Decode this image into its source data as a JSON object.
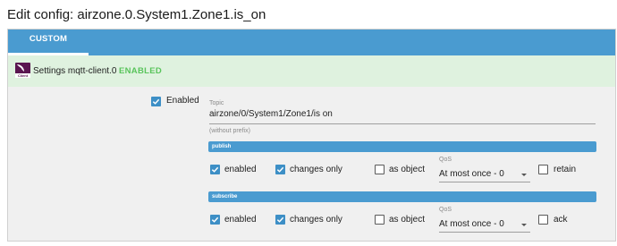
{
  "page": {
    "title": "Edit config: airzone.0.System1.Zone1.is_on"
  },
  "tabs": [
    {
      "label": "CUSTOM SETTINGS",
      "active": true
    }
  ],
  "adapter": {
    "logo_text": "Client",
    "name": "Settings mqtt-client.0",
    "status": "ENABLED"
  },
  "form": {
    "enabled": {
      "label": "Enabled",
      "checked": true
    },
    "topic": {
      "label": "Topic",
      "value": "airzone/0/System1/Zone1/is on",
      "hint": "(without prefix)"
    },
    "publish": {
      "header": "publish",
      "enabled": {
        "label": "enabled",
        "checked": true
      },
      "changes_only": {
        "label": "changes only",
        "checked": true
      },
      "as_object": {
        "label": "as object",
        "checked": false
      },
      "qos": {
        "label": "QoS",
        "value": "At most once - 0"
      },
      "extra": {
        "label": "retain",
        "checked": false
      }
    },
    "subscribe": {
      "header": "subscribe",
      "enabled": {
        "label": "enabled",
        "checked": true
      },
      "changes_only": {
        "label": "changes only",
        "checked": true
      },
      "as_object": {
        "label": "as object",
        "checked": false
      },
      "qos": {
        "label": "QoS",
        "value": "At most once - 0"
      },
      "extra": {
        "label": "ack",
        "checked": false
      }
    }
  },
  "colors": {
    "accent": "#4a9bd0",
    "checkbox": "#3d8fc6",
    "status_green": "#59c45b",
    "header_bg": "#dff2df"
  }
}
